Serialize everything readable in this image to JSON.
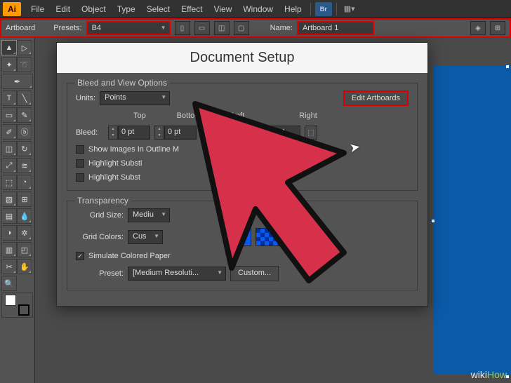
{
  "app": "Ai",
  "menubar": [
    "File",
    "Edit",
    "Object",
    "Type",
    "Select",
    "Effect",
    "View",
    "Window",
    "Help"
  ],
  "br_label": "Br",
  "optbar": {
    "title": "Artboard",
    "presets_label": "Presets:",
    "presets_value": "B4",
    "name_label": "Name:",
    "name_value": "Artboard 1"
  },
  "dialog": {
    "title": "Document Setup",
    "bleed_group": "Bleed and View Options",
    "units_label": "Units:",
    "units_value": "Points",
    "edit_artboards": "Edit Artboards",
    "cols": {
      "top": "Top",
      "bottom": "Bottom",
      "left": "Left",
      "right": "Right"
    },
    "bleed_label": "Bleed:",
    "bleed": {
      "top": "0 pt",
      "bottom": "0 pt",
      "left": "0",
      "right": "0 pt"
    },
    "checks": {
      "show_images": "Show Images In Outline M",
      "hl_sub1": "Highlight Substi",
      "hl_sub2": "Highlight Subst"
    },
    "trans_group": "Transparency",
    "grid_size_label": "Grid Size:",
    "grid_size_value": "Mediu",
    "grid_colors_label": "Grid Colors:",
    "grid_colors_value": "Cus",
    "simulate": "Simulate Colored Paper",
    "preset_label": "Preset:",
    "preset_value": "[Medium Resoluti...",
    "custom": "Custom..."
  },
  "watermark": {
    "wiki": "wiki",
    "how": "How"
  },
  "colors": {
    "accent": "#d00",
    "canvas_art": "#0a5aa8",
    "swatch": "#0a5af0"
  }
}
